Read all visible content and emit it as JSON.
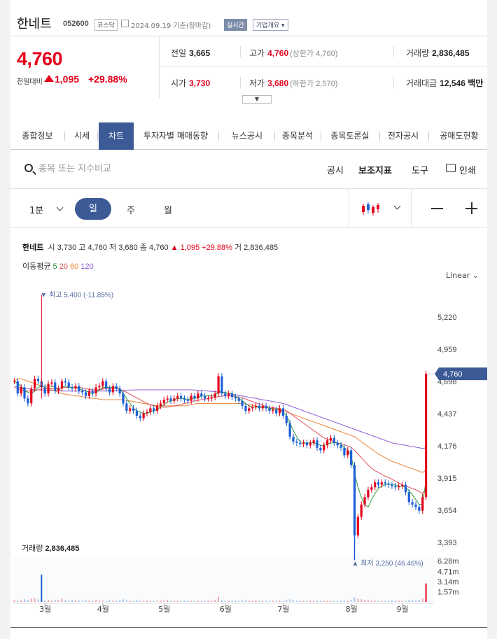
{
  "header": {
    "name": "한네트",
    "code": "052600",
    "market": "코스닥",
    "date": "2024.09.19 기준(장마감)",
    "realtime": "실시간",
    "company_info": "기업개요"
  },
  "price": {
    "current": "4,760",
    "change_label": "전일대비",
    "change": "1,095",
    "change_pct": "+29.88%"
  },
  "stats": {
    "prev_label": "전일",
    "prev": "3,665",
    "high_label": "고가",
    "high": "4,760",
    "high_sub": "(상한가 4,760)",
    "volume_label": "거래량",
    "volume": "2,836,485",
    "open_label": "시가",
    "open": "3,730",
    "low_label": "저가",
    "low": "3,680",
    "low_sub": "(하한가 2,570)",
    "amount_label": "거래대금",
    "amount": "12,546 백만"
  },
  "tabs": [
    "종합정보",
    "시세",
    "차트",
    "투자자별 매매동향",
    "뉴스공시",
    "종목분석",
    "종목토론실",
    "전자공시",
    "공매도현황"
  ],
  "active_tab": "차트",
  "search": {
    "placeholder": "종목 또는 지수비교"
  },
  "tools": {
    "notice": "공시",
    "indicator": "보조지표",
    "tool": "도구",
    "print": "인쇄"
  },
  "periods": {
    "minute": "1분",
    "day": "일",
    "week": "주",
    "month": "월"
  },
  "zoom": {
    "out": "−",
    "in": "+"
  },
  "legend": {
    "name": "한네트",
    "open_k": "시",
    "open": "3,730",
    "high_k": "고",
    "high": "4,760",
    "low_k": "저",
    "low": "3,680",
    "close_k": "종",
    "close": "4,760",
    "chg": "▲ 1,095 +29.88%",
    "vol_k": "거",
    "vol": "2,836,485",
    "ma_label": "이동평균",
    "ma": [
      "5",
      "20",
      "60",
      "120"
    ],
    "ma_colors": [
      "#2e9a3a",
      "#e0505a",
      "#e8843a",
      "#8b5cd6"
    ]
  },
  "scale_mode": "Linear",
  "chart_data": {
    "type": "candlestick",
    "price_axis": [
      "5,220",
      "4,959",
      "4,698",
      "4,437",
      "4,176",
      "3,915",
      "3,654",
      "3,393"
    ],
    "price_ticks": [
      5220,
      4959,
      4698,
      4437,
      4176,
      3915,
      3654,
      3393
    ],
    "current_price_tag": "4,760",
    "current_price": 4760,
    "high_annotation": "최고 5,400 (-11.85%)",
    "high_value": 5400,
    "low_annotation": "최저 3,250 (46.46%)",
    "low_value": 3250,
    "x_labels": [
      "3월",
      "4월",
      "5월",
      "6월",
      "7월",
      "8월",
      "9월"
    ],
    "volume_label": "거래량",
    "volume": "2,836,485",
    "volume_axis": [
      "6.28m",
      "4.71m",
      "3.14m",
      "1.57m"
    ],
    "volume_ticks": [
      6.28,
      4.71,
      3.14,
      1.57
    ],
    "volume_max": 7.0,
    "price_range": [
      3250,
      5400
    ],
    "closes": [
      4700,
      4600,
      4650,
      4560,
      4520,
      4640,
      4720,
      4700,
      4650,
      4600,
      4680,
      4690,
      4620,
      4640,
      4700,
      4690,
      4650,
      4640,
      4660,
      4620,
      4610,
      4580,
      4620,
      4600,
      4650,
      4660,
      4700,
      4640,
      4610,
      4660,
      4640,
      4600,
      4520,
      4460,
      4480,
      4460,
      4420,
      4400,
      4440,
      4450,
      4480,
      4460,
      4500,
      4520,
      4550,
      4560,
      4540,
      4560,
      4580,
      4560,
      4550,
      4540,
      4580,
      4560,
      4600,
      4580,
      4560,
      4560,
      4570,
      4600,
      4740,
      4600,
      4580,
      4600,
      4570,
      4560,
      4540,
      4500,
      4460,
      4480,
      4490,
      4500,
      4480,
      4500,
      4480,
      4460,
      4470,
      4440,
      4480,
      4420,
      4360,
      4250,
      4210,
      4200,
      4190,
      4200,
      4180,
      4200,
      4220,
      4160,
      4140,
      4180,
      4220,
      4240,
      4200,
      4180,
      4160,
      4100,
      4140,
      4020,
      3450,
      3600,
      3700,
      3760,
      3820,
      3840,
      3880,
      3860,
      3880,
      3870,
      3860,
      3850,
      3840,
      3850,
      3860,
      3800,
      3720,
      3700,
      3680,
      3650,
      3760,
      4760
    ],
    "ma5": [
      4700,
      4680,
      4660,
      4620,
      4610,
      4600,
      4620,
      4650,
      4660,
      4660,
      4660,
      4660,
      4650,
      4640,
      4650,
      4660,
      4650,
      4650,
      4650,
      4640,
      4630,
      4620,
      4610,
      4600,
      4610,
      4630,
      4650,
      4650,
      4650,
      4650,
      4650,
      4640,
      4600,
      4560,
      4520,
      4480,
      4460,
      4450,
      4440,
      4440,
      4450,
      4460,
      4470,
      4490,
      4510,
      4530,
      4540,
      4550,
      4560,
      4560,
      4560,
      4550,
      4560,
      4560,
      4570,
      4580,
      4580,
      4580,
      4580,
      4580,
      4620,
      4610,
      4610,
      4600,
      4600,
      4580,
      4560,
      4540,
      4520,
      4500,
      4490,
      4490,
      4490,
      4490,
      4490,
      4480,
      4480,
      4470,
      4470,
      4450,
      4420,
      4360,
      4300,
      4250,
      4210,
      4200,
      4200,
      4200,
      4200,
      4190,
      4180,
      4180,
      4190,
      4200,
      4200,
      4200,
      4190,
      4160,
      4140,
      4100,
      3950,
      3840,
      3760,
      3700,
      3680,
      3740,
      3790,
      3830,
      3850,
      3860,
      3870,
      3860,
      3860,
      3850,
      3850,
      3840,
      3810,
      3780,
      3740,
      3700,
      3700,
      3900
    ],
    "ma20": [
      4650,
      4640,
      4630,
      4620,
      4620,
      4620,
      4625,
      4630,
      4635,
      4640,
      4640,
      4640,
      4640,
      4640,
      4645,
      4650,
      4650,
      4650,
      4650,
      4650,
      4645,
      4640,
      4635,
      4630,
      4630,
      4630,
      4635,
      4640,
      4640,
      4640,
      4640,
      4635,
      4625,
      4610,
      4595,
      4580,
      4565,
      4550,
      4535,
      4520,
      4510,
      4500,
      4495,
      4490,
      4490,
      4490,
      4495,
      4500,
      4505,
      4510,
      4520,
      4525,
      4530,
      4540,
      4545,
      4550,
      4555,
      4560,
      4565,
      4570,
      4575,
      4580,
      4580,
      4580,
      4580,
      4575,
      4570,
      4565,
      4555,
      4545,
      4535,
      4525,
      4515,
      4505,
      4495,
      4490,
      4485,
      4480,
      4475,
      4470,
      4460,
      4440,
      4420,
      4400,
      4380,
      4360,
      4340,
      4320,
      4300,
      4280,
      4260,
      4240,
      4230,
      4220,
      4210,
      4200,
      4195,
      4185,
      4175,
      4165,
      4140,
      4110,
      4080,
      4050,
      4020,
      3995,
      3975,
      3960,
      3945,
      3930,
      3920,
      3905,
      3890,
      3875,
      3860,
      3850,
      3840,
      3830,
      3820,
      3805,
      3790,
      3830
    ],
    "ma60": [
      4700,
      4720,
      4720,
      4710,
      4700,
      4690,
      4680,
      4670,
      4660,
      4650,
      4640,
      4630,
      4620,
      4610,
      4600,
      4595,
      4590,
      4585,
      4580,
      4580,
      4575,
      4570,
      4565,
      4560,
      4560,
      4555,
      4550,
      4550,
      4550,
      4550,
      4550,
      4550,
      4550,
      4545,
      4540,
      4535,
      4530,
      4525,
      4520,
      4515,
      4510,
      4505,
      4500,
      4500,
      4500,
      4500,
      4500,
      4500,
      4500,
      4500,
      4500,
      4505,
      4510,
      4515,
      4520,
      4520,
      4520,
      4520,
      4520,
      4520,
      4520,
      4520,
      4520,
      4520,
      4520,
      4520,
      4520,
      4520,
      4515,
      4510,
      4505,
      4500,
      4495,
      4490,
      4485,
      4480,
      4475,
      4470,
      4465,
      4460,
      4450,
      4440,
      4430,
      4420,
      4410,
      4400,
      4390,
      4380,
      4370,
      4360,
      4350,
      4340,
      4330,
      4320,
      4310,
      4300,
      4290,
      4280,
      4270,
      4260,
      4250,
      4230,
      4210,
      4190,
      4170,
      4150,
      4130,
      4110,
      4095,
      4080,
      4065,
      4050,
      4040,
      4030,
      4020,
      4010,
      4000,
      3990,
      3980,
      3970,
      3960,
      3980
    ],
    "ma120": [
      4660,
      4655,
      4650,
      4645,
      4640,
      4635,
      4630,
      4630,
      4628,
      4626,
      4625,
      4624,
      4623,
      4622,
      4621,
      4620,
      4620,
      4620,
      4620,
      4620,
      4620,
      4620,
      4620,
      4620,
      4620,
      4620,
      4620,
      4621,
      4622,
      4623,
      4624,
      4625,
      4626,
      4627,
      4628,
      4629,
      4630,
      4630,
      4630,
      4630,
      4630,
      4630,
      4630,
      4630,
      4630,
      4630,
      4630,
      4630,
      4630,
      4630,
      4630,
      4630,
      4630,
      4628,
      4626,
      4624,
      4622,
      4620,
      4618,
      4615,
      4612,
      4610,
      4605,
      4600,
      4595,
      4590,
      4585,
      4580,
      4575,
      4570,
      4565,
      4560,
      4555,
      4550,
      4545,
      4540,
      4535,
      4530,
      4525,
      4520,
      4510,
      4500,
      4490,
      4480,
      4470,
      4460,
      4450,
      4440,
      4430,
      4420,
      4410,
      4400,
      4390,
      4380,
      4370,
      4360,
      4350,
      4340,
      4330,
      4320,
      4310,
      4300,
      4290,
      4280,
      4270,
      4260,
      4250,
      4240,
      4230,
      4220,
      4210,
      4200,
      4195,
      4190,
      4185,
      4180,
      4175,
      4170,
      4165,
      4160,
      4155,
      4160
    ],
    "volumes": [
      0.3,
      0.2,
      0.25,
      0.4,
      0.3,
      0.5,
      0.6,
      0.4,
      0.3,
      0.2,
      0.3,
      0.2,
      0.3,
      0.3,
      0.5,
      0.3,
      0.2,
      0.3,
      0.3,
      0.2,
      0.2,
      0.3,
      0.2,
      0.2,
      0.3,
      0.2,
      0.2,
      0.2,
      0.3,
      0.2,
      0.2,
      0.3,
      0.4,
      0.3,
      0.2,
      0.2,
      0.3,
      0.2,
      0.2,
      0.2,
      0.2,
      0.2,
      0.2,
      0.2,
      0.2,
      0.3,
      0.2,
      0.2,
      0.2,
      0.2,
      0.2,
      0.2,
      0.2,
      0.2,
      0.2,
      0.2,
      0.2,
      0.2,
      0.2,
      0.3,
      0.8,
      0.3,
      0.2,
      0.2,
      0.2,
      0.2,
      0.2,
      0.2,
      0.3,
      0.2,
      0.2,
      0.2,
      0.2,
      0.2,
      0.2,
      0.2,
      0.2,
      0.2,
      0.2,
      0.2,
      0.3,
      0.4,
      0.3,
      0.2,
      0.2,
      0.2,
      0.2,
      0.2,
      0.2,
      0.2,
      0.2,
      0.2,
      0.2,
      0.2,
      0.2,
      0.2,
      0.2,
      0.2,
      0.2,
      0.3,
      0.7,
      0.5,
      0.4,
      0.3,
      0.3,
      0.2,
      0.2,
      0.2,
      0.2,
      0.2,
      0.2,
      0.2,
      0.2,
      0.2,
      0.2,
      0.2,
      0.3,
      0.3,
      0.2,
      0.3,
      0.5,
      2.84
    ],
    "spike_volume_index": 8,
    "spike_volume": 4.2
  }
}
